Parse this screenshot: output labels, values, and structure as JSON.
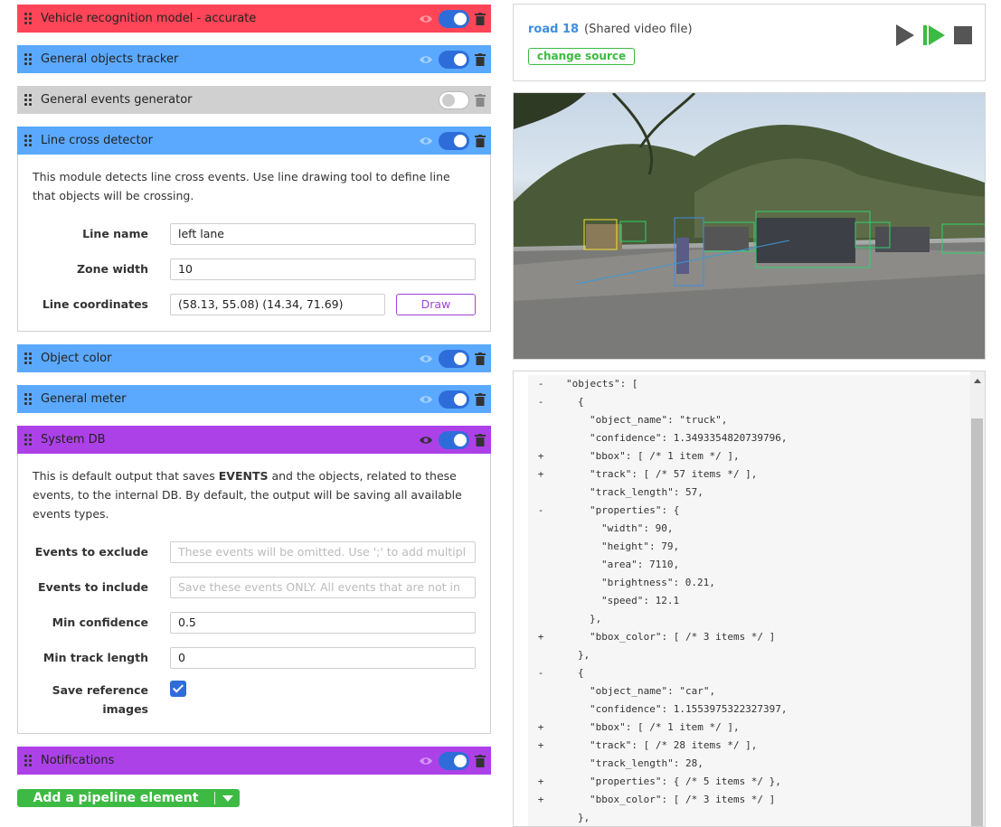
{
  "pipeline": {
    "modules": [
      {
        "title": "Vehicle recognition model - accurate",
        "color": "#ff4557",
        "enabled": true
      },
      {
        "title": "General objects tracker",
        "color": "#5aa9ff",
        "enabled": true
      },
      {
        "title": "General events generator",
        "color": "#d0d0d0",
        "enabled": false
      },
      {
        "title": "Line cross detector",
        "color": "#5aa9ff",
        "enabled": true
      },
      {
        "title": "Object color",
        "color": "#5aa9ff",
        "enabled": true
      },
      {
        "title": "General meter",
        "color": "#5aa9ff",
        "enabled": true
      },
      {
        "title": "System DB",
        "color": "#ad41e8",
        "enabled": true
      },
      {
        "title": "Notifications",
        "color": "#ad41e8",
        "enabled": true
      }
    ],
    "line_cross": {
      "description": "This module detects line cross events. Use line drawing tool to define line that objects will be crossing.",
      "line_name_label": "Line name",
      "line_name_value": "left lane",
      "zone_width_label": "Zone width",
      "zone_width_value": "10",
      "line_coords_label": "Line coordinates",
      "line_coords_value": "(58.13, 55.08) (14.34, 71.69)",
      "draw_label": "Draw"
    },
    "system_db": {
      "description_pre": "This is default output that saves ",
      "description_bold": "EVENTS",
      "description_post": " and the objects, related to these events, to the internal DB. By default, the output will be saving all available events types.",
      "exclude_label": "Events to exclude",
      "exclude_placeholder": "These events will be omitted. Use ';' to add multipl",
      "include_label": "Events to include",
      "include_placeholder": "Save these events ONLY. All events that are not in",
      "min_conf_label": "Min confidence",
      "min_conf_value": "0.5",
      "min_track_label": "Min track length",
      "min_track_value": "0",
      "save_ref_label": "Save reference images",
      "save_ref_checked": true
    },
    "add_button_label": "Add a pipeline element"
  },
  "source": {
    "name": "road 18",
    "type": "(Shared video file)",
    "change_label": "change source"
  },
  "json_view": {
    "lines": [
      {
        "marker": "-",
        "indent": 0,
        "text": "\"objects\": ["
      },
      {
        "marker": "-",
        "indent": 1,
        "text": "{"
      },
      {
        "marker": "",
        "indent": 2,
        "text": "\"object_name\": \"truck\","
      },
      {
        "marker": "",
        "indent": 2,
        "text": "\"confidence\": 1.3493354820739796,"
      },
      {
        "marker": "+",
        "indent": 2,
        "text": "\"bbox\": [ /* 1 item */ ],"
      },
      {
        "marker": "+",
        "indent": 2,
        "text": "\"track\": [ /* 57 items */ ],"
      },
      {
        "marker": "",
        "indent": 2,
        "text": "\"track_length\": 57,"
      },
      {
        "marker": "-",
        "indent": 2,
        "text": "\"properties\": {"
      },
      {
        "marker": "",
        "indent": 3,
        "text": "\"width\": 90,"
      },
      {
        "marker": "",
        "indent": 3,
        "text": "\"height\": 79,"
      },
      {
        "marker": "",
        "indent": 3,
        "text": "\"area\": 7110,"
      },
      {
        "marker": "",
        "indent": 3,
        "text": "\"brightness\": 0.21,"
      },
      {
        "marker": "",
        "indent": 3,
        "text": "\"speed\": 12.1"
      },
      {
        "marker": "",
        "indent": 2,
        "text": "},"
      },
      {
        "marker": "+",
        "indent": 2,
        "text": "\"bbox_color\": [ /* 3 items */ ]"
      },
      {
        "marker": "",
        "indent": 1,
        "text": "},"
      },
      {
        "marker": "-",
        "indent": 1,
        "text": "{"
      },
      {
        "marker": "",
        "indent": 2,
        "text": "\"object_name\": \"car\","
      },
      {
        "marker": "",
        "indent": 2,
        "text": "\"confidence\": 1.1553975322327397,"
      },
      {
        "marker": "+",
        "indent": 2,
        "text": "\"bbox\": [ /* 1 item */ ],"
      },
      {
        "marker": "+",
        "indent": 2,
        "text": "\"track\": [ /* 28 items */ ],"
      },
      {
        "marker": "",
        "indent": 2,
        "text": "\"track_length\": 28,"
      },
      {
        "marker": "+",
        "indent": 2,
        "text": "\"properties\": { /* 5 items */ },"
      },
      {
        "marker": "+",
        "indent": 2,
        "text": "\"bbox_color\": [ /* 3 items */ ]"
      },
      {
        "marker": "",
        "indent": 1,
        "text": "},"
      }
    ]
  }
}
